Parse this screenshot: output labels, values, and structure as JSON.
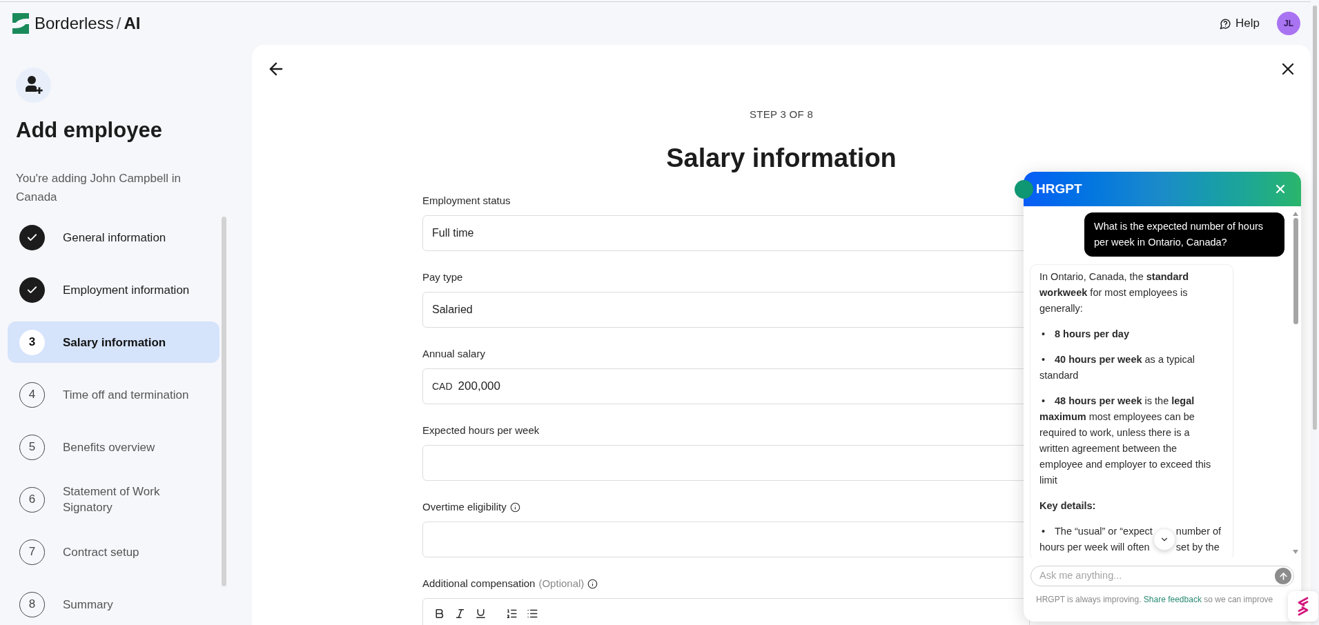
{
  "header": {
    "logo": {
      "name": "Borderless",
      "separator": "/",
      "suffix": "AI"
    },
    "help": "Help",
    "avatar_initials": "JL"
  },
  "sidebar": {
    "title": "Add employee",
    "subtitle": "You're adding John Campbell in Canada",
    "steps": [
      {
        "label": "General information",
        "completed": true,
        "selected": false
      },
      {
        "label": "Employment information",
        "completed": true,
        "selected": false
      },
      {
        "number": "3",
        "label": "Salary information",
        "completed": false,
        "selected": true
      },
      {
        "number": "4",
        "label": "Time off and termination",
        "completed": false,
        "selected": false
      },
      {
        "number": "5",
        "label": "Benefits overview",
        "completed": false,
        "selected": false
      },
      {
        "number": "6",
        "label": "Statement of Work Signatory",
        "completed": false,
        "selected": false
      },
      {
        "number": "7",
        "label": "Contract setup",
        "completed": false,
        "selected": false
      },
      {
        "number": "8",
        "label": "Summary",
        "completed": false,
        "selected": false
      }
    ]
  },
  "form": {
    "step_indicator": "STEP 3 OF 8",
    "title": "Salary information",
    "fields": [
      {
        "kind": "text",
        "label": "Employment status",
        "value": "Full time"
      },
      {
        "kind": "text",
        "label": "Pay type",
        "value": "Salaried"
      },
      {
        "kind": "currency",
        "label": "Annual salary",
        "prefix": "CAD",
        "value": "200,000"
      },
      {
        "kind": "text",
        "label": "Expected hours per week"
      },
      {
        "kind": "text",
        "label": "Overtime eligibility",
        "info": true
      },
      {
        "kind": "rich_text",
        "label": "Additional compensation",
        "optional_note": "(Optional)",
        "info": true
      }
    ]
  },
  "chat": {
    "title": "HRGPT",
    "messages": [
      {
        "kind": "user",
        "text": "What is the expected number of hours per week in Ontario, Canada?"
      },
      {
        "kind": "assistant",
        "blocks": [
          {
            "kind": "paragraph",
            "text": "In Ontario, Canada, the **standard workweek** for most employees is generally:"
          },
          {
            "kind": "bullet",
            "marker": "•",
            "bold": true,
            "text": "8 hours per day"
          },
          {
            "kind": "bullet",
            "marker": "•",
            "bold": false,
            "text": "**40 hours per week** as a typical standard"
          },
          {
            "kind": "bullet",
            "marker": "•",
            "bold": false,
            "text": "**48 hours per week** is the **legal maximum** most employees can be required to work, unless there is a written agreement between the employee and employer to exceed this limit"
          },
          {
            "kind": "heading",
            "text": "Key details:"
          },
          {
            "kind": "covered_bullet",
            "marker": "•",
            "lines": [
              [
                "The “usual” or “expect",
                "number of"
              ],
              [
                "hours per week will often",
                "set by the"
              ]
            ]
          }
        ]
      }
    ],
    "input": {
      "placeholder": "Ask me anything..."
    },
    "footer": {
      "text": "HRGPT is always improving.",
      "link": "Share feedback",
      "text_after": "so we can improve"
    }
  }
}
